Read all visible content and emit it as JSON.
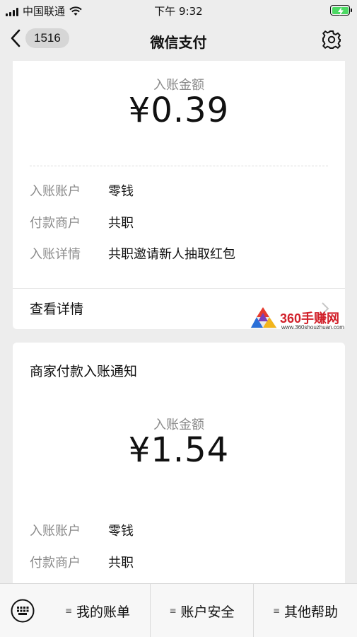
{
  "status_bar": {
    "carrier": "中国联通",
    "time": "下午 9:32"
  },
  "nav": {
    "back_count": "1516",
    "title": "微信支付",
    "settings_icon": "gear-icon"
  },
  "card1": {
    "amount_label": "入账金额",
    "amount": "¥0.39",
    "rows": [
      {
        "key": "入账账户",
        "value": "零钱"
      },
      {
        "key": "付款商户",
        "value": "共职"
      },
      {
        "key": "入账详情",
        "value": "共职邀请新人抽取红包"
      }
    ],
    "details_link": "查看详情"
  },
  "card2": {
    "title": "商家付款入账通知",
    "amount_label": "入账金额",
    "amount": "¥1.54",
    "rows": [
      {
        "key": "入账账户",
        "value": "零钱"
      },
      {
        "key": "付款商户",
        "value": "共职"
      }
    ]
  },
  "watermark": {
    "brand": "360手赚网",
    "url": "www.360shouzhuan.com"
  },
  "bottom_menu": [
    {
      "label": "我的账单"
    },
    {
      "label": "账户安全"
    },
    {
      "label": "其他帮助"
    }
  ],
  "colors": {
    "background": "#ededed",
    "card": "#ffffff",
    "secondary_text": "#8a8a8a",
    "battery_green": "#4cd964",
    "watermark_red": "#d1202a"
  }
}
